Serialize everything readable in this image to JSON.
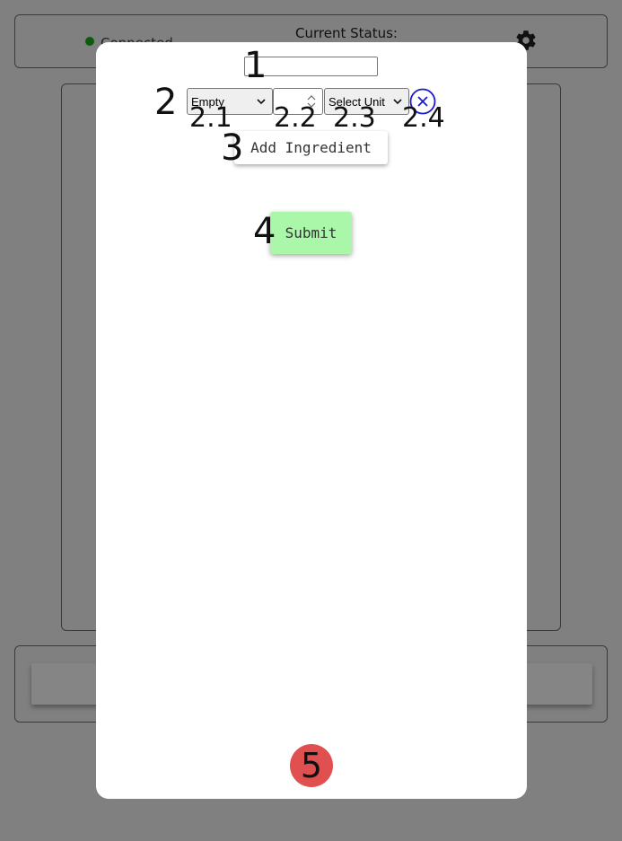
{
  "background": {
    "connection_label": "Connected",
    "status_label": "Current Status:",
    "settings_icon": "gear-icon",
    "colors": {
      "connected_dot": "#0d5a0d",
      "overlay": "#808080"
    }
  },
  "modal": {
    "recipe_name_input": {
      "value": "",
      "placeholder": ""
    },
    "ingredient_row": {
      "ingredient_select": {
        "selected": "Empty"
      },
      "quantity_input": {
        "value": ""
      },
      "unit_select": {
        "selected": "Select Unit"
      },
      "remove_icon": "close-circle-icon"
    },
    "add_ingredient_label": "Add Ingredient",
    "submit_label": "Submit",
    "close_button_label": "5",
    "colors": {
      "submit": "#aaf7aa",
      "close": "#e05050",
      "remove_icon": "#1a1ad0"
    }
  },
  "annotations": {
    "m1": "1",
    "m2": "2",
    "m2_1": "2.1",
    "m2_2": "2.2",
    "m2_3": "2.3",
    "m2_4": "2.4",
    "m3": "3",
    "m4": "4"
  }
}
